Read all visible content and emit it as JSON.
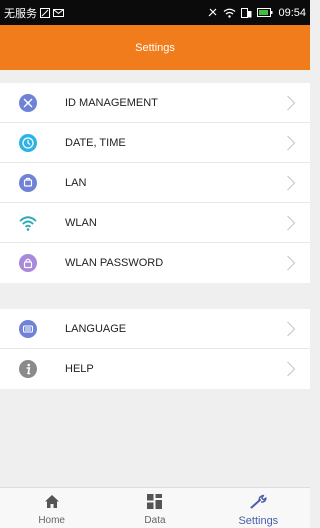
{
  "status_bar": {
    "carrier": "无服务",
    "time": "09:54"
  },
  "header": {
    "title": "Settings"
  },
  "groups": [
    {
      "items": [
        {
          "label": "ID MANAGEMENT",
          "icon": "id-icon",
          "color": "#6f82d6"
        },
        {
          "label": "DATE, TIME",
          "icon": "clock-icon",
          "color": "#2bb3e6"
        },
        {
          "label": "LAN",
          "icon": "lan-icon",
          "color": "#6f82d6"
        },
        {
          "label": "WLAN",
          "icon": "wifi-icon",
          "color": "#27aab7"
        },
        {
          "label": "WLAN PASSWORD",
          "icon": "lock-icon",
          "color": "#a78ad9"
        }
      ]
    },
    {
      "items": [
        {
          "label": "LANGUAGE",
          "icon": "keyboard-icon",
          "color": "#6f82d6"
        },
        {
          "label": "HELP",
          "icon": "info-icon",
          "color": "#8a8a8a"
        }
      ]
    }
  ],
  "tabs": [
    {
      "label": "Home",
      "icon": "home-icon"
    },
    {
      "label": "Data",
      "icon": "grid-icon"
    },
    {
      "label": "Settings",
      "icon": "wrench-icon",
      "active": true
    }
  ],
  "colors": {
    "header_bg": "#f07c1b",
    "active_tab": "#4a5ea8"
  }
}
